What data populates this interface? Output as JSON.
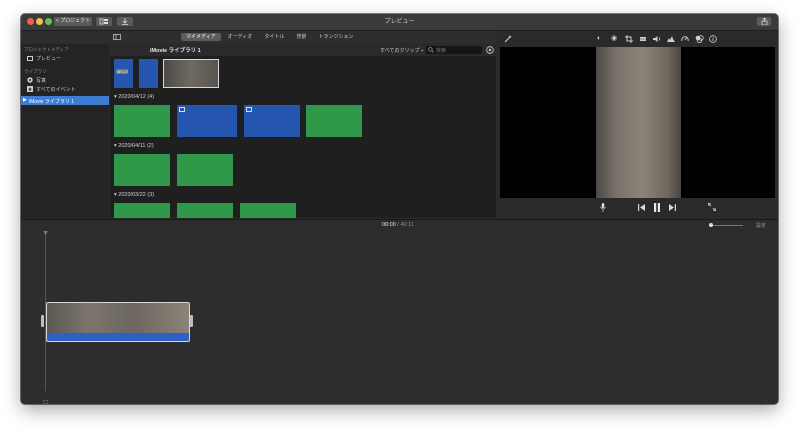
{
  "window": {
    "title": "プレビュー"
  },
  "toolbar": {
    "projects_label": "< プロジェクト"
  },
  "tabs": [
    {
      "label": "マイメディア",
      "active": true
    },
    {
      "label": "オーディオ",
      "active": false
    },
    {
      "label": "タイトル",
      "active": false
    },
    {
      "label": "背景",
      "active": false
    },
    {
      "label": "トランジション",
      "active": false
    }
  ],
  "sidebar": {
    "project_media_heading": "プロジェクトメディア",
    "preview_item": "プレビュー",
    "libraries_heading": "ライブラリ",
    "photos_item": "写真",
    "all_events_item": "すべてのイベント",
    "library_item": "iMovie ライブラリ 1"
  },
  "browser": {
    "title": "iMovie ライブラリ 1",
    "filter": "すべてのクリップ ÷",
    "search_placeholder": "検索",
    "thumb_label": "4K1.0",
    "groups": [
      {
        "date": "2020/04/12 (4)"
      },
      {
        "date": "2020/04/11 (2)"
      },
      {
        "date": "2020/03/22 (3)"
      }
    ]
  },
  "timeline": {
    "current": "00:00",
    "separator": "/",
    "total": "40:11",
    "settings_label": "設定"
  },
  "colors": {
    "selection": "#3e7dd4",
    "clip_green": "#2e9a49",
    "clip_blue": "#2556b0",
    "audio": "#2f5fc4"
  },
  "icons": [
    "close-light",
    "minimize-light",
    "zoom-light",
    "magic-wand-icon",
    "color-balance-icon",
    "color-correction-icon",
    "crop-icon",
    "stabilization-icon",
    "volume-icon",
    "noise-reduction-icon",
    "speed-icon",
    "filter-icon",
    "info-icon",
    "microphone-icon",
    "skip-back-icon",
    "pause-icon",
    "skip-forward-icon",
    "fullscreen-icon"
  ]
}
